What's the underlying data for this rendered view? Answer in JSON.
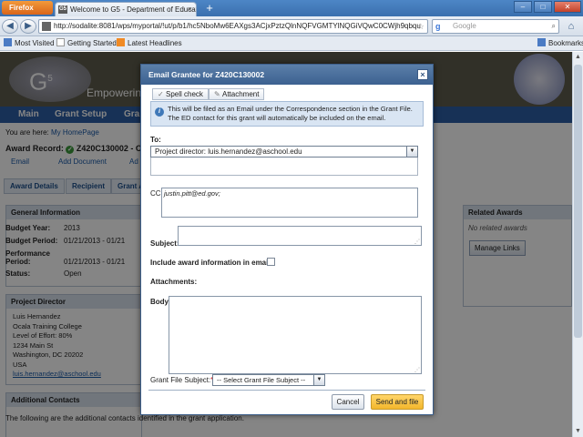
{
  "browser": {
    "menu_button": "Firefox",
    "tab_title": "Welcome to G5 - Department of Educati...",
    "tab_close": "×",
    "new_tab": "+",
    "url": "http://sodalite:8081/wps/myportal/!ut/p/b1/hc5NboMw6EAXgs3ACjxPztzQlnNQFVGMTYlNQGiVQwC0CWjh9qbqu",
    "search_placeholder": "Google",
    "bookmarks": [
      "Most Visited",
      "Getting Started",
      "Latest Headlines"
    ],
    "bookmarks_menu": "Bookmarks"
  },
  "page": {
    "banner_text": "Empowering",
    "menu": [
      "Main",
      "Grant Setup",
      "Gra"
    ],
    "breadcrumb_prefix": "You are here: ",
    "breadcrumb_link": "My HomePage",
    "record_label": "Award Record:",
    "record_id": "Z420C130002 - Oca",
    "toolbar": [
      "Email",
      "Add Document",
      "Ad"
    ],
    "tabs": [
      "Award Details",
      "Recipient",
      "Grant A"
    ],
    "general_info": {
      "title": "General Information",
      "rows": [
        {
          "label": "Budget Year:",
          "value": "2013"
        },
        {
          "label": "Budget Period:",
          "value": "01/21/2013 - 01/21"
        },
        {
          "label": "Performance Period:",
          "value": "01/21/2013 - 01/21"
        },
        {
          "label": "Status:",
          "value": "Open"
        }
      ]
    },
    "project_director": {
      "title": "Project Director",
      "lines": [
        "Luis Hernandez",
        "Ocala Training College",
        "Level of Effort: 80%",
        "1234 Main St",
        "Washington, DC 20202",
        "USA"
      ],
      "email": "luis.hernandez@aschool.edu"
    },
    "additional_contacts": {
      "title": "Additional Contacts",
      "text": "The following are the additional contacts identified in the grant application."
    },
    "related_awards": {
      "title": "Related Awards",
      "none": "No related awards",
      "button": "Manage Links"
    }
  },
  "modal": {
    "title": "Email Grantee for Z420C130002",
    "close": "×",
    "toolbar": {
      "spell_check": "Spell check",
      "attachment": "Attachment"
    },
    "info": "This will be filed as an Email under the Correspondence section in the Grant File. The ED contact for this grant will automatically be included on the email.",
    "to_label": "To:",
    "to_value": "Project director: luis.hernandez@aschool.edu",
    "cc_label": "CC:",
    "cc_value": "justin.pitt@ed.gov;",
    "subject_label": "Subject:",
    "include_label": "Include award information in email:",
    "attachments_label": "Attachments:",
    "body_label": "Body:",
    "gfs_label": "Grant File Subject:",
    "gfs_required": "*",
    "gfs_value": "-- Select Grant File Subject --",
    "cancel": "Cancel",
    "send": "Send and file"
  }
}
